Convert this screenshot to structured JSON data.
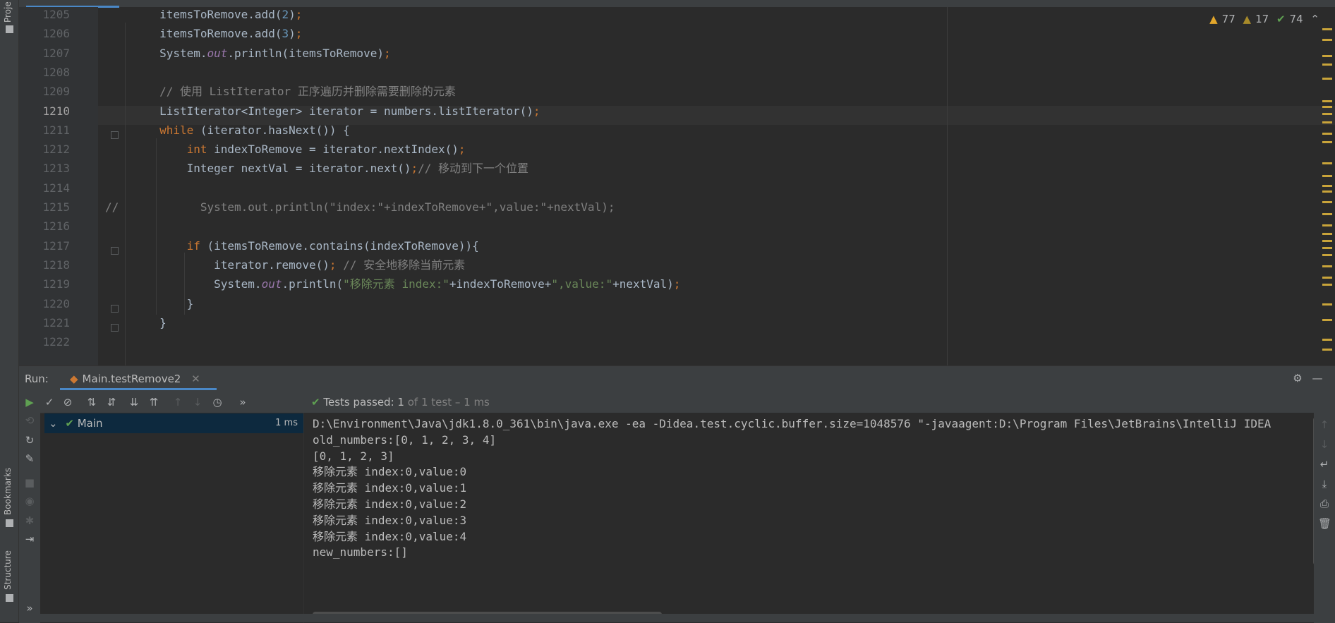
{
  "left_strip": {
    "project_label": "Proje",
    "bookmarks_label": "Bookmarks",
    "structure_label": "Structure"
  },
  "editor": {
    "lines": [
      {
        "no": "1205",
        "html": "        itemsToRemove.add(<span class=\"num\">2</span>)<span class=\"kw\">;</span>"
      },
      {
        "no": "1206",
        "html": "        itemsToRemove.add(<span class=\"num\">3</span>)<span class=\"kw\">;</span>"
      },
      {
        "no": "1207",
        "html": "        System.<span class=\"field\">out</span>.println(itemsToRemove)<span class=\"kw\">;</span>"
      },
      {
        "no": "1208",
        "html": ""
      },
      {
        "no": "1209",
        "html": "        <span class=\"cmt\">// 使用 ListIterator 正序遍历并删除需要删除的元素</span>"
      },
      {
        "no": "1210",
        "html": "        ListIterator&lt;Integer&gt; iterator = numbers.listIterator()<span class=\"kw\">;</span>"
      },
      {
        "no": "1211",
        "html": "        <span class=\"kw\">while</span> (iterator.hasNext()) {"
      },
      {
        "no": "1212",
        "html": "            <span class=\"kw\">int</span> indexToRemove = iterator.nextIndex()<span class=\"kw\">;</span>"
      },
      {
        "no": "1213",
        "html": "            Integer nextVal = iterator.next()<span class=\"kw\">;</span><span class=\"cmt\">// 移动到下一个位置</span>"
      },
      {
        "no": "1214",
        "html": ""
      },
      {
        "no": "1215",
        "html": "<span class=\"cmt\">//            System.out.println(\"index:\"+indexToRemove+\",value:\"+nextVal);</span>"
      },
      {
        "no": "1216",
        "html": ""
      },
      {
        "no": "1217",
        "html": "            <span class=\"kw\">if</span> (itemsToRemove.contains(indexToRemove)){"
      },
      {
        "no": "1218",
        "html": "                iterator.remove()<span class=\"kw\">;</span> <span class=\"cmt\">// 安全地移除当前元素</span>"
      },
      {
        "no": "1219",
        "html": "                System.<span class=\"field\">out</span>.println(<span class=\"str\">\"移除元素 index:\"</span>+indexToRemove+<span class=\"str\">\",value:\"</span>+nextVal)<span class=\"kw\">;</span>"
      },
      {
        "no": "1220",
        "html": "            }"
      },
      {
        "no": "1221",
        "html": "        }"
      },
      {
        "no": "1222",
        "html": ""
      }
    ],
    "inspection": {
      "warnings": "77",
      "weak_warnings": "17",
      "ok": "74"
    }
  },
  "run": {
    "label": "Run:",
    "tab": "Main.testRemove2",
    "tests_passed_label": "Tests passed:",
    "tests_passed_count": "1",
    "tests_passed_detail": "of 1 test – 1 ms",
    "tree_root": "Main",
    "tree_time": "1 ms",
    "console_lines": [
      "D:\\Environment\\Java\\jdk1.8.0_361\\bin\\java.exe -ea -Didea.test.cyclic.buffer.size=1048576 \"-javaagent:D:\\Program Files\\JetBrains\\IntelliJ IDEA",
      "old_numbers:[0, 1, 2, 3, 4]",
      "[0, 1, 2, 3]",
      "移除元素 index:0,value:0",
      "移除元素 index:0,value:1",
      "移除元素 index:0,value:2",
      "移除元素 index:0,value:3",
      "移除元素 index:0,value:4",
      "new_numbers:[]"
    ]
  },
  "colors": {
    "keyword": "#cc7832",
    "number": "#6897bb",
    "string": "#6a8759",
    "comment": "#808080",
    "field": "#9876aa",
    "accent": "#4a88c7",
    "passed": "#5fa052"
  }
}
